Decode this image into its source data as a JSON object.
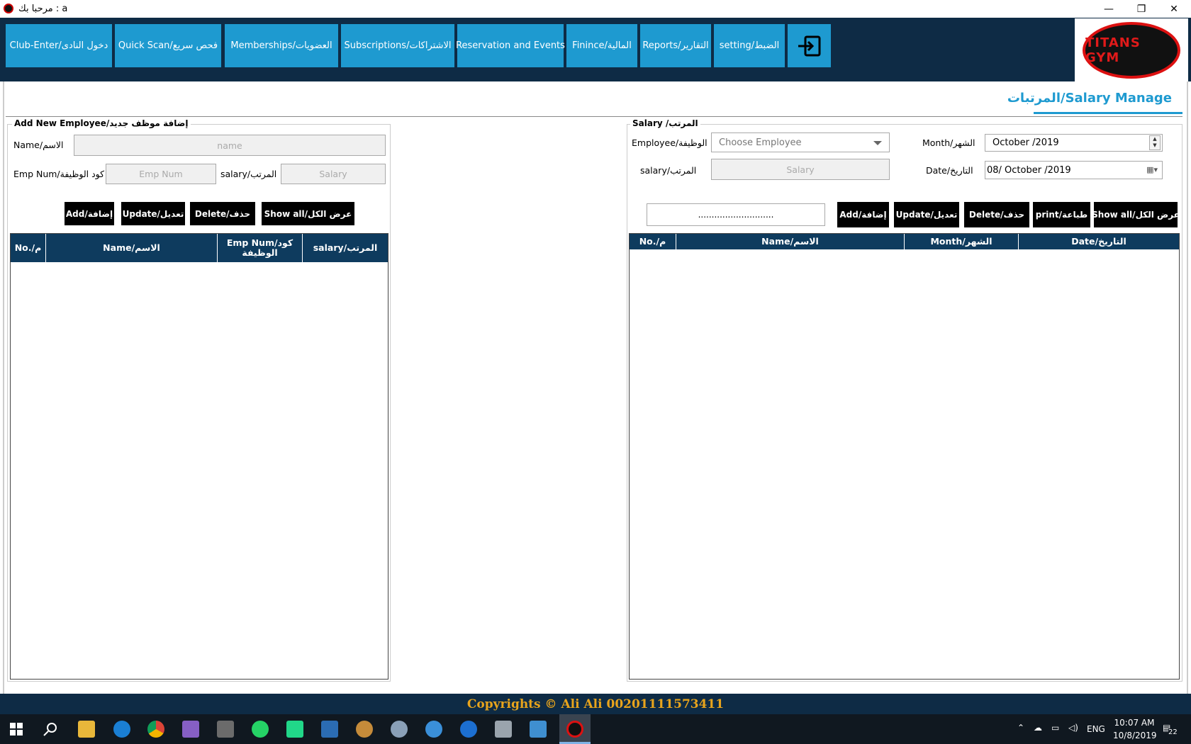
{
  "window": {
    "title": "مرحبا بك : a",
    "controls": {
      "minimize": "—",
      "restore": "❐",
      "close": "✕"
    }
  },
  "nav": {
    "items": [
      "Club-Enter/دخول النادى",
      "Quick Scan/فحص سريع",
      "Memberships/العضويات",
      "Subscriptions/الاشتراكات",
      "Reservation and Events",
      "Finince/المالية",
      "Reports/التقارير",
      "setting/الضبط"
    ],
    "exit_icon": "logout-icon",
    "logo_text": "TITANS GYM"
  },
  "page": {
    "title": "المرتبات/Salary Manage"
  },
  "add_employee": {
    "legend": "Add New Employee/إضافة موظف جديد",
    "name_label": "Name/الاسم",
    "name_placeholder": "name",
    "empnum_label": "Emp Num/كود الوظيفة",
    "empnum_placeholder": "Emp Num",
    "salary_label": "salary/المرتب",
    "salary_placeholder": "Salary",
    "buttons": {
      "add": "Add/إضافة",
      "update": "Update/تعديل",
      "delete": "Delete/حذف",
      "show_all": "Show all/عرض الكل"
    },
    "grid_headers": [
      "No./م",
      "Name/الاسم",
      "Emp Num/كود الوظيفة",
      "salary/المرتب"
    ]
  },
  "salary": {
    "legend": "Salary /المرتب",
    "employee_label": "Employee/الوظيفة",
    "employee_placeholder": "Choose Employee",
    "salary_label": "salary/المرتب",
    "salary_placeholder": "Salary",
    "month_label": "Month/الشهر",
    "month_value": "October   /2019",
    "date_label": "Date/التاريخ",
    "date_value": "08/  October   /2019",
    "search_value": "............................",
    "buttons": {
      "add": "Add/إضافة",
      "update": "Update/تعديل",
      "delete": "Delete/حذف",
      "print": "print/طباعة",
      "show_all": "Show all/عرض الكل"
    },
    "grid_headers": [
      "No./م",
      "Name/الاسم",
      "Month/الشهر",
      "Date/التاريخ"
    ]
  },
  "footer": {
    "text": "Copyrights  ©  Ali Ali 00201111573411"
  },
  "taskbar": {
    "lang": "ENG",
    "time": "10:07 AM",
    "date": "10/8/2019",
    "notification_count": "22"
  },
  "colors": {
    "nav_bg": "#0e2b45",
    "nav_button": "#1e9ad0",
    "grid_header": "#0e3b5e",
    "footer_text": "#e8a41c"
  }
}
